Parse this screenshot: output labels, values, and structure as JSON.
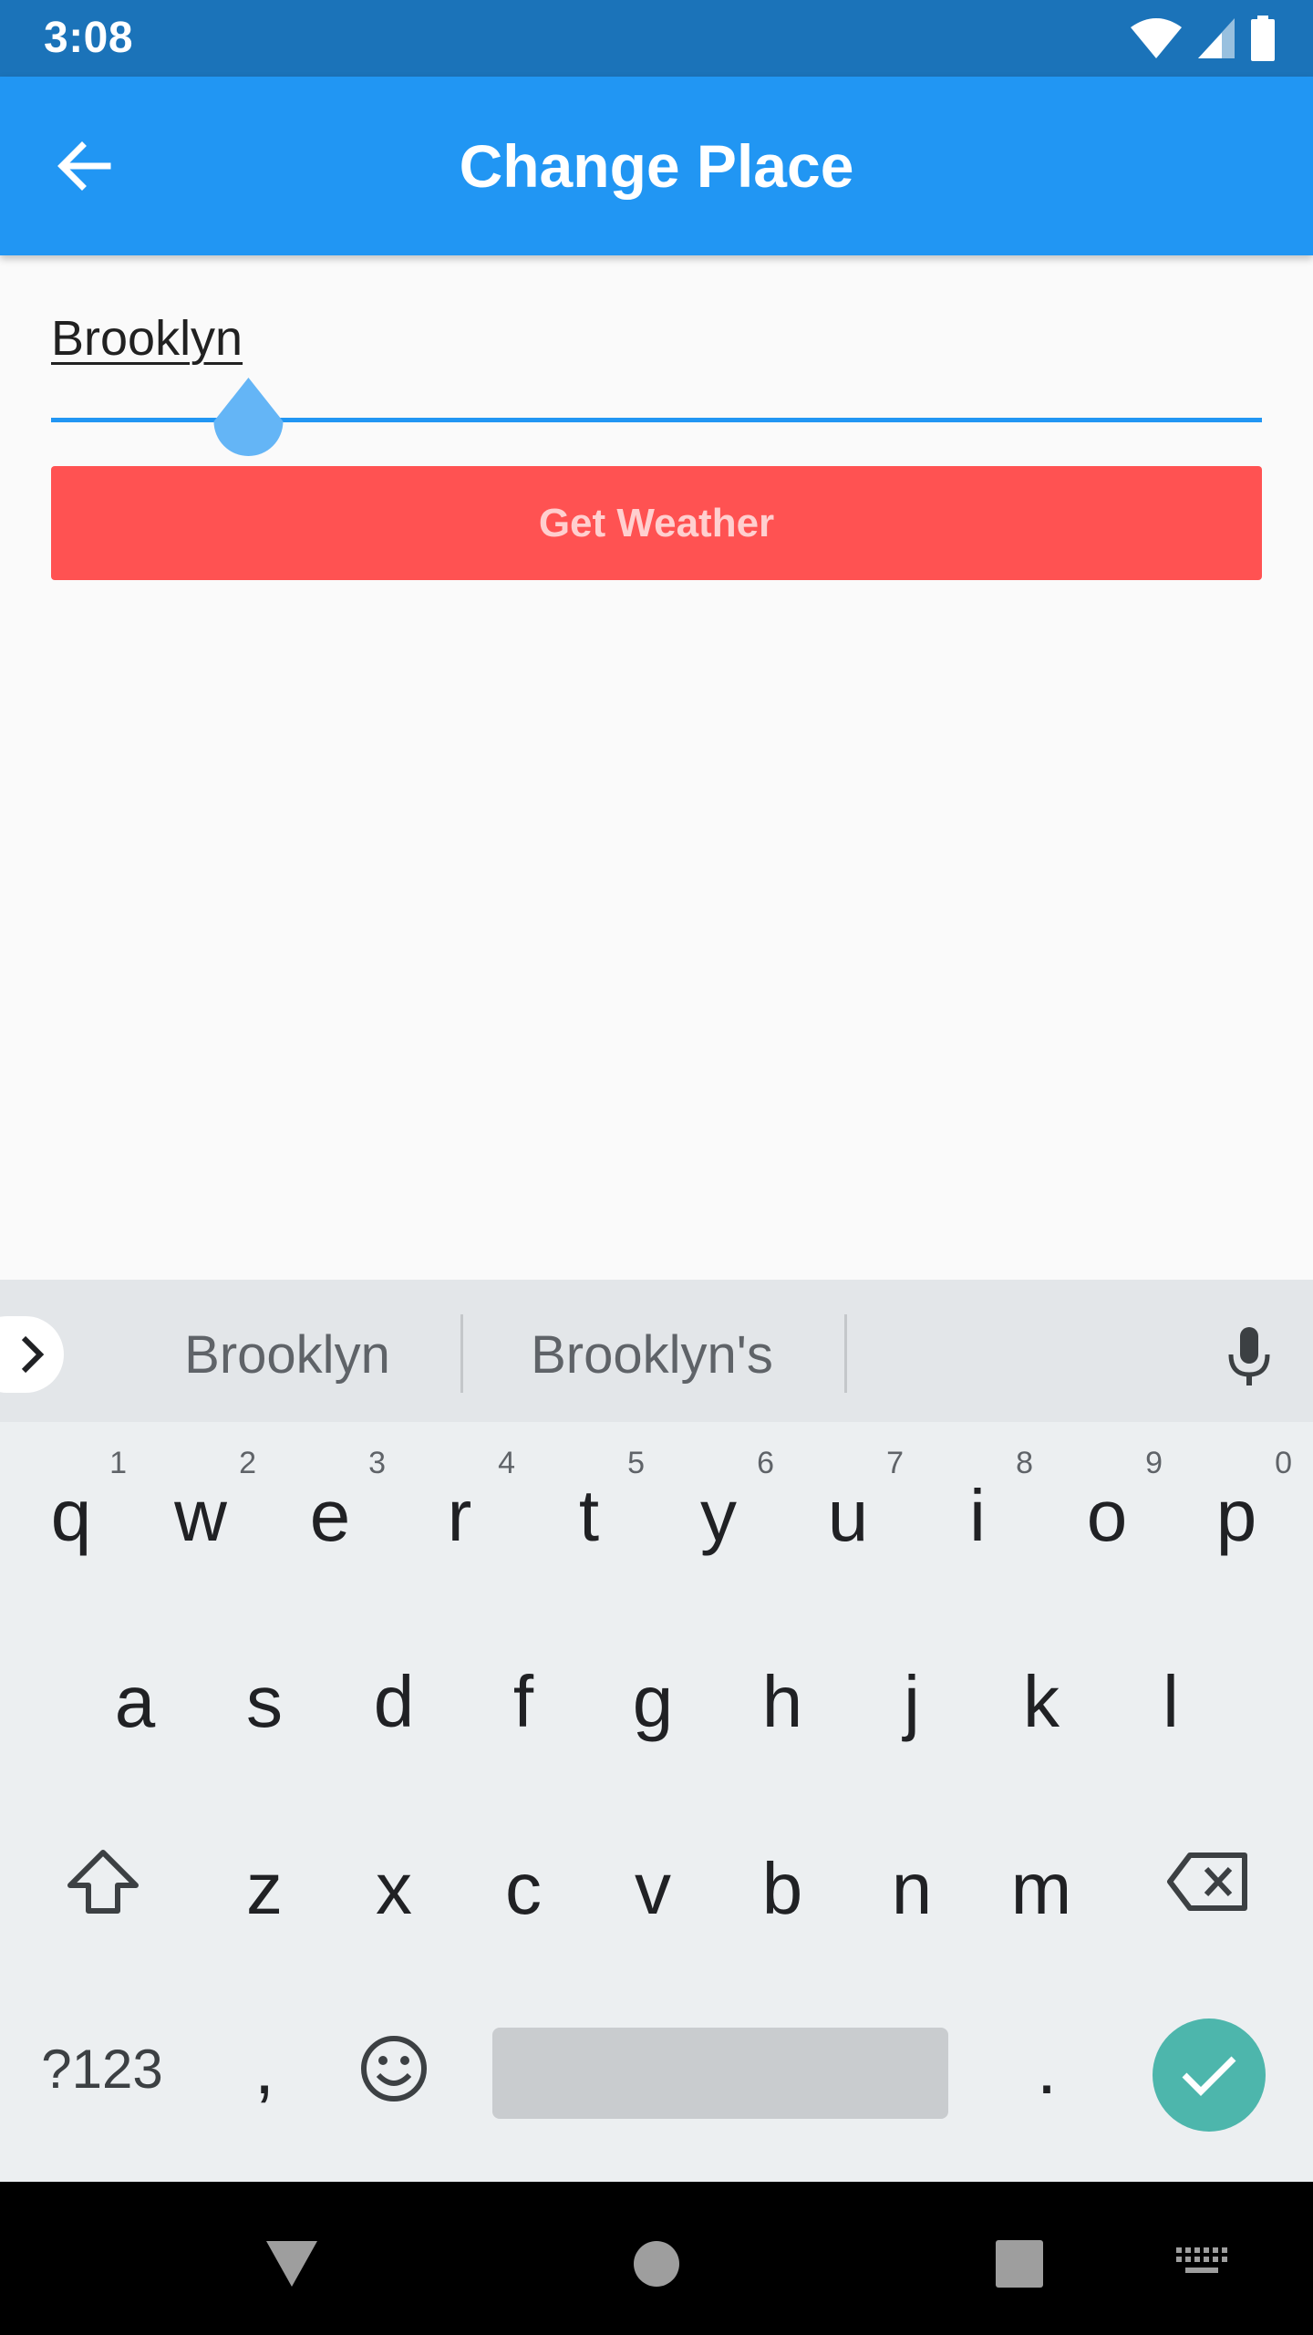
{
  "status_bar": {
    "time": "3:08",
    "icons": [
      "wifi-icon",
      "signal-icon",
      "battery-icon"
    ]
  },
  "app_bar": {
    "title": "Change Place",
    "back_icon": "arrow-back-icon",
    "color": "#2196f3"
  },
  "form": {
    "place_value": "Brooklyn",
    "slider_level": 0.163,
    "get_weather_label": "Get Weather",
    "button_color": "#ff5252"
  },
  "keyboard": {
    "suggestions": [
      "Brooklyn",
      "Brooklyn's"
    ],
    "row1": [
      {
        "key": "q",
        "hint": "1"
      },
      {
        "key": "w",
        "hint": "2"
      },
      {
        "key": "e",
        "hint": "3"
      },
      {
        "key": "r",
        "hint": "4"
      },
      {
        "key": "t",
        "hint": "5"
      },
      {
        "key": "y",
        "hint": "6"
      },
      {
        "key": "u",
        "hint": "7"
      },
      {
        "key": "i",
        "hint": "8"
      },
      {
        "key": "o",
        "hint": "9"
      },
      {
        "key": "p",
        "hint": "0"
      }
    ],
    "row2": [
      "a",
      "s",
      "d",
      "f",
      "g",
      "h",
      "j",
      "k",
      "l"
    ],
    "row3": [
      "z",
      "x",
      "c",
      "v",
      "b",
      "n",
      "m"
    ],
    "symbols_label": "?123",
    "comma_label": ",",
    "period_label": ".",
    "enter_color": "#4db6ac"
  },
  "nav_bar": {
    "icons": [
      "back-triangle-icon",
      "home-circle-icon",
      "recents-square-icon",
      "keyboard-switch-icon"
    ]
  }
}
